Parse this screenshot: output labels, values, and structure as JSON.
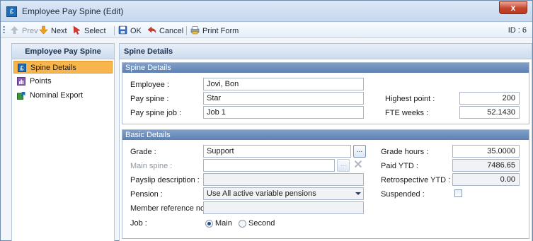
{
  "window": {
    "title": "Employee Pay Spine (Edit)",
    "close_label": "x"
  },
  "toolbar": {
    "prev": "Prev",
    "next": "Next",
    "select": "Select",
    "ok": "OK",
    "cancel": "Cancel",
    "print_form": "Print Form",
    "record_id": "ID : 6"
  },
  "sidebar": {
    "title": "Employee Pay Spine",
    "items": [
      {
        "label": "Spine Details",
        "icon": "spine-details-icon",
        "active": true
      },
      {
        "label": "Points",
        "icon": "points-icon",
        "active": false
      },
      {
        "label": "Nominal Export",
        "icon": "nominal-export-icon",
        "active": false
      }
    ]
  },
  "main": {
    "title": "Spine Details"
  },
  "spine_details": {
    "title": "Spine Details",
    "employee_label": "Employee :",
    "employee_value": "Jovi, Bon",
    "pay_spine_label": "Pay spine :",
    "pay_spine_value": "Star",
    "pay_spine_job_label": "Pay spine job :",
    "pay_spine_job_value": "Job 1",
    "highest_point_label": "Highest point :",
    "highest_point_value": "200",
    "fte_weeks_label": "FTE weeks :",
    "fte_weeks_value": "52.1430"
  },
  "basic_details": {
    "title": "Basic Details",
    "grade_label": "Grade :",
    "grade_value": "Support",
    "grade_button_label": "...",
    "main_spine_label": "Main spine :",
    "main_spine_value": "",
    "main_spine_button_label": "...",
    "main_spine_clear_label": "✕",
    "payslip_description_label": "Payslip description :",
    "payslip_description_value": "",
    "pension_label": "Pension :",
    "pension_value": "Use All active variable pensions",
    "member_reference_label": "Member reference no :",
    "member_reference_value": "",
    "job_label": "Job :",
    "job_options": [
      "Main",
      "Second"
    ],
    "job_selected": "Main",
    "grade_hours_label": "Grade hours :",
    "grade_hours_value": "35.0000",
    "paid_ytd_label": "Paid YTD :",
    "paid_ytd_value": "7486.65",
    "retrospective_ytd_label": "Retrospective YTD :",
    "retrospective_ytd_value": "0.00",
    "suspended_label": "Suspended :",
    "suspended_checked": false
  },
  "colors": {
    "accent_active": "#f6b64d",
    "group_header": "#5d81b2",
    "close_button": "#c6442c"
  }
}
